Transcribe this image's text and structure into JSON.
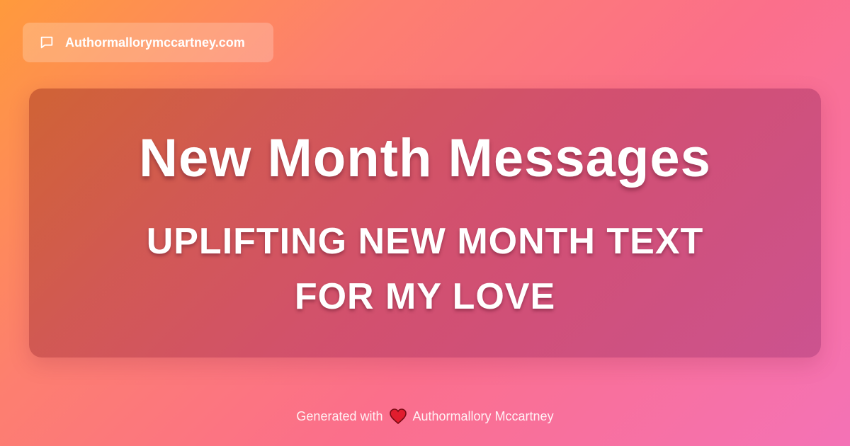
{
  "badge": {
    "icon": "chat-bubble-icon",
    "site_name": "Authormallorymccartney.com"
  },
  "card": {
    "title": "New Month Messages",
    "subtitle": "UPLIFTING NEW MONTH TEXT FOR MY LOVE"
  },
  "footer": {
    "prefix": "Generated with",
    "icon": "heart-icon",
    "author": "Authormallory Mccartney"
  },
  "colors": {
    "gradient_start": "#ff9a3c",
    "gradient_end": "#f472b6",
    "heart": "#e11d2e"
  }
}
